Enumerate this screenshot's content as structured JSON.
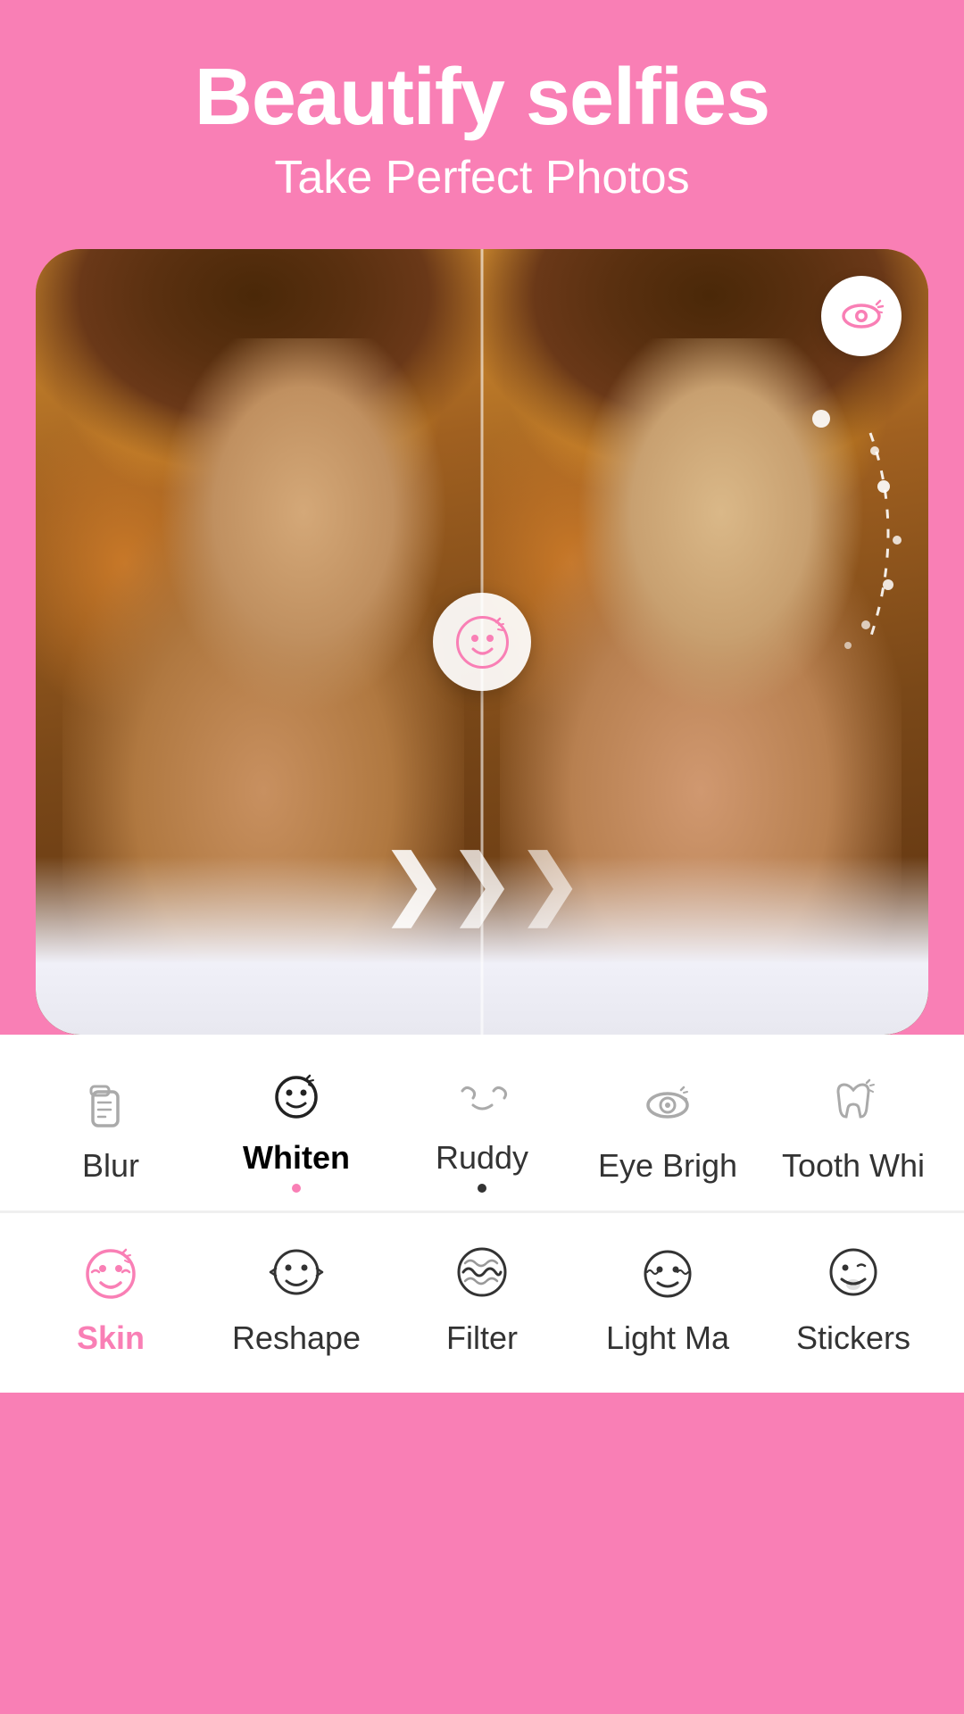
{
  "app": {
    "title": "Beautify selfies",
    "subtitle": "Take Perfect Photos"
  },
  "colors": {
    "pink": "#f97fb5",
    "white": "#ffffff",
    "dark": "#222222",
    "gray": "#888888",
    "active_dot": "#f97fb5"
  },
  "toolbar_top": {
    "items": [
      {
        "id": "blur",
        "label": "Blur",
        "active": false,
        "dot": false
      },
      {
        "id": "whiten",
        "label": "Whiten",
        "active": true,
        "dot": true
      },
      {
        "id": "ruddy",
        "label": "Ruddy",
        "active": false,
        "dot": true
      },
      {
        "id": "eye_brighten",
        "label": "Eye Brigh",
        "active": false,
        "dot": false
      },
      {
        "id": "tooth_whiten",
        "label": "Tooth Whi",
        "active": false,
        "dot": false
      }
    ]
  },
  "toolbar_bottom": {
    "items": [
      {
        "id": "skin",
        "label": "Skin",
        "active": true
      },
      {
        "id": "reshape",
        "label": "Reshape",
        "active": false
      },
      {
        "id": "filter",
        "label": "Filter",
        "active": false
      },
      {
        "id": "light_makeup",
        "label": "Light Ma",
        "active": false
      },
      {
        "id": "stickers",
        "label": "Stickers",
        "active": false
      }
    ]
  },
  "eye_button": {
    "label": "compare-eye"
  },
  "arrows": "❯❯❯",
  "drag_handle": "face-beautify-handle"
}
